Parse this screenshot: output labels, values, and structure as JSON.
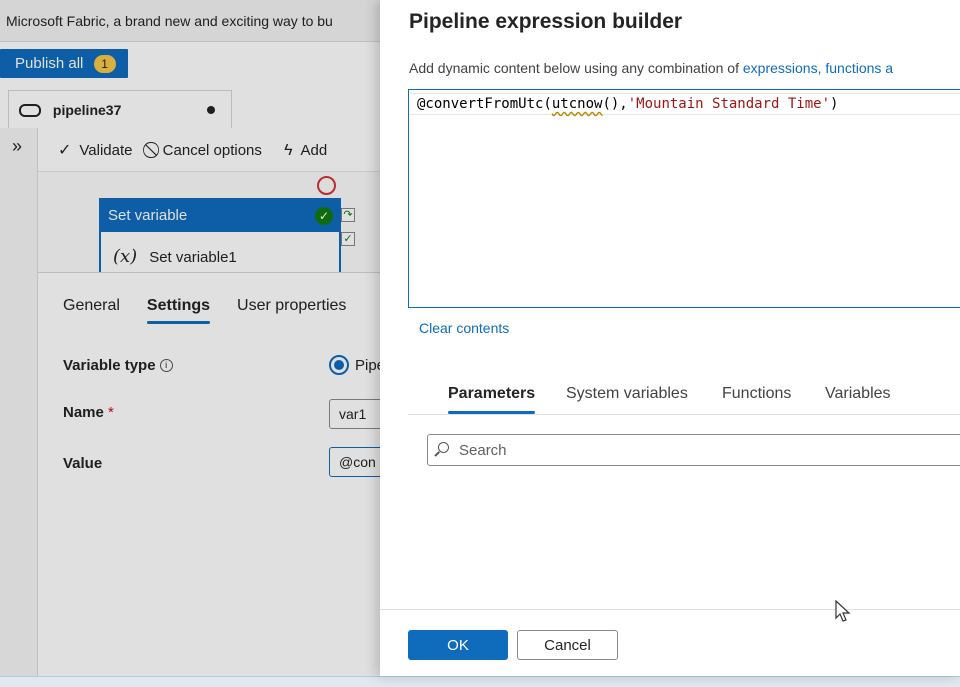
{
  "app": {
    "window_title": "Microsoft Fabric, a brand new and exciting way to bu",
    "publish_label": "Publish all",
    "publish_count": "1"
  },
  "pipeline_tab": {
    "label": "pipeline37"
  },
  "toolbar": {
    "expand_glyph": "»",
    "validate_label": "Validate",
    "cancel_options_label": "Cancel options",
    "add_label": "Add"
  },
  "activity": {
    "header": "Set variable",
    "name": "Set variable1",
    "icon_glyph": "(x)"
  },
  "properties": {
    "tabs": [
      "General",
      "Settings",
      "User properties"
    ],
    "active_tab": "Settings",
    "variable_type_label": "Variable type",
    "variable_type_option": "Pipe",
    "name_label": "Name",
    "name_required_mark": "*",
    "name_value": "var1",
    "value_label": "Value",
    "value_value": "@con"
  },
  "builder": {
    "title": "Pipeline expression builder",
    "subtitle_prefix": "Add dynamic content below using any combination of ",
    "subtitle_link": "expressions, functions a",
    "expression": {
      "prefix": "@convertFromUtc(",
      "fn": "utcnow",
      "mid": "(),",
      "string": "'Mountain Standard Time'",
      "suffix": ")"
    },
    "clear_label": "Clear contents",
    "tabs": [
      "Parameters",
      "System variables",
      "Functions",
      "Variables"
    ],
    "active_tab": "Parameters",
    "search_placeholder": "Search",
    "ok_label": "OK",
    "cancel_label": "Cancel"
  },
  "colors": {
    "accent": "#0f6cbd",
    "success": "#107c10",
    "error": "#d13438",
    "badge": "#f7c948",
    "string_literal": "#a31515"
  }
}
